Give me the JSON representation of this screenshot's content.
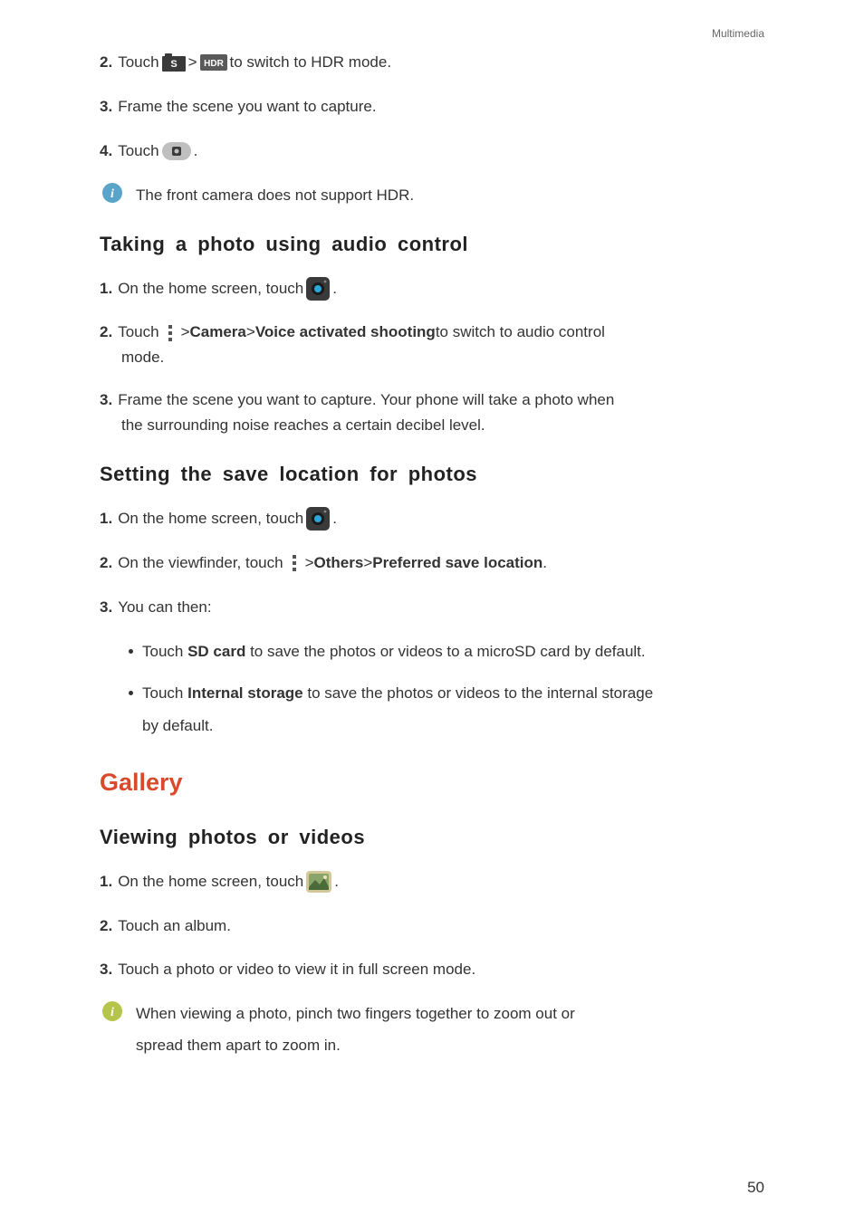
{
  "header": {
    "section": "Multimedia"
  },
  "hdr": {
    "step2_prefix": "Touch ",
    "step2_mid": " > ",
    "step2_suffix": " to switch to HDR mode.",
    "step3": "Frame the scene you want to capture.",
    "step4_prefix": "Touch ",
    "step4_suffix": " .",
    "note": "The front camera does not support HDR."
  },
  "audio": {
    "heading": "Taking a photo using audio control",
    "step1_prefix": "On the home screen, touch ",
    "step1_suffix": " .",
    "step2_prefix": "Touch ",
    "step2_mid1": " > ",
    "step2_camera": "Camera",
    "step2_mid2": " > ",
    "step2_voice": "Voice activated shooting",
    "step2_suffix": " to switch to audio control",
    "step2_line2": "mode.",
    "step3": "Frame the scene you want to capture. Your phone will take a photo when",
    "step3_line2": "the surrounding noise reaches a certain decibel level."
  },
  "save": {
    "heading": "Setting the save location for photos",
    "step1_prefix": "On the home screen, touch ",
    "step1_suffix": " .",
    "step2_prefix": "On the viewfinder, touch ",
    "step2_mid1": " > ",
    "step2_others": "Others",
    "step2_mid2": " > ",
    "step2_pref": "Preferred save location",
    "step2_suffix": ".",
    "step3": "You can then:",
    "bullet1_prefix": "Touch ",
    "bullet1_bold": "SD card",
    "bullet1_suffix": " to save the photos or videos to a microSD card by default.",
    "bullet2_prefix": "Touch ",
    "bullet2_bold": "Internal storage",
    "bullet2_suffix": " to save the photos or videos to the internal storage",
    "bullet2_line2": "by default."
  },
  "gallery": {
    "heading": "Gallery",
    "subheading": "Viewing photos or videos",
    "step1_prefix": "On the home screen, touch ",
    "step1_suffix": " .",
    "step2": "Touch an album.",
    "step3": "Touch a photo or video to view it in full screen mode.",
    "note": "When viewing a photo, pinch two fingers together to zoom out or",
    "note_line2": "spread them apart to zoom in."
  },
  "nums": {
    "n1": "1.",
    "n2": "2.",
    "n3": "3.",
    "n4": "4."
  },
  "page": "50"
}
